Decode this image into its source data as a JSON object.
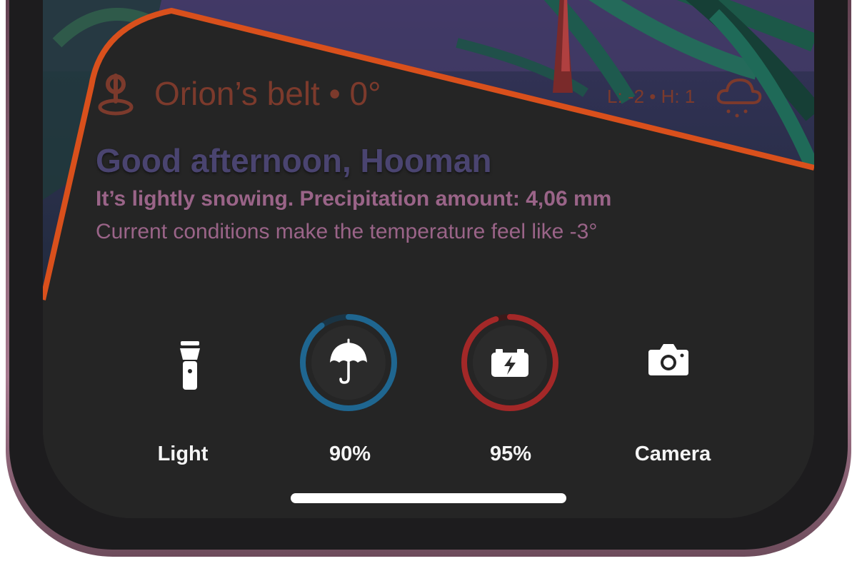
{
  "weather": {
    "location": "Orion’s belt • 0°",
    "low_high": "L: -2 • H: 1",
    "greeting": "Good afternoon, Hooman",
    "condition": "It’s lightly snowing. Precipitation amount: 4,06 mm",
    "feels_like": "Current conditions make the temperature feel like -3°",
    "location_icon": "map-pin-icon",
    "weather_icon": "cloud-snow-icon"
  },
  "controls": [
    {
      "label": "Light",
      "icon": "flashlight-icon"
    },
    {
      "label": "90%",
      "icon": "umbrella-icon",
      "ring_fraction": 0.9,
      "ring_color": "#1f6690"
    },
    {
      "label": "95%",
      "icon": "battery-charging-icon",
      "ring_fraction": 0.95,
      "ring_color": "#a32828"
    },
    {
      "label": "Camera",
      "icon": "camera-icon"
    }
  ],
  "colors": {
    "accent_orange": "#d9501c",
    "panel": "#252525",
    "greeting": "#4a4470",
    "subtitle": "#9a6488"
  }
}
